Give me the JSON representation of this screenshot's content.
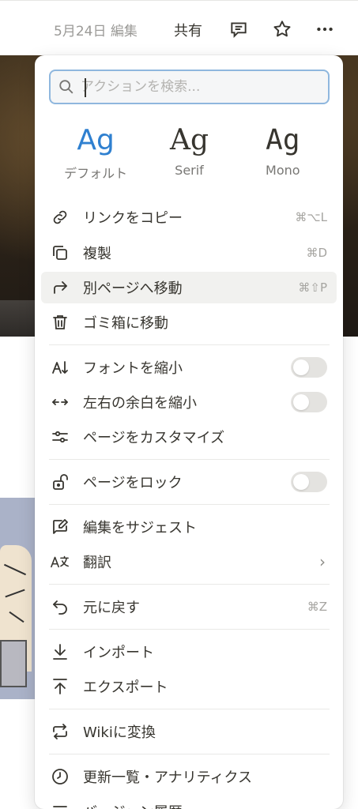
{
  "topbar": {
    "edited": "5月24日 編集",
    "share": "共有",
    "icons": [
      "comment-icon",
      "star-icon",
      "more-icon"
    ]
  },
  "menu": {
    "search": {
      "placeholder": "アクションを検索..."
    },
    "fonts": [
      {
        "sample": "Ag",
        "label": "デフォルト",
        "selected": true
      },
      {
        "sample": "Ag",
        "label": "Serif",
        "selected": false
      },
      {
        "sample": "Ag",
        "label": "Mono",
        "selected": false
      }
    ],
    "items": {
      "copy_link": {
        "label": "リンクをコピー",
        "shortcut": "⌘⌥L",
        "icon": "link-icon"
      },
      "duplicate": {
        "label": "複製",
        "shortcut": "⌘D",
        "icon": "duplicate-icon"
      },
      "move": {
        "label": "別ページへ移動",
        "shortcut": "⌘⇧P",
        "icon": "move-arrow-icon"
      },
      "trash": {
        "label": "ゴミ箱に移動",
        "icon": "trash-icon"
      },
      "small_text": {
        "label": "フォントを縮小",
        "toggle": false,
        "icon": "font-size-icon"
      },
      "full_width": {
        "label": "左右の余白を縮小",
        "toggle": false,
        "icon": "width-arrows-icon"
      },
      "customize": {
        "label": "ページをカスタマイズ",
        "icon": "sliders-icon"
      },
      "lock": {
        "label": "ページをロック",
        "toggle": false,
        "icon": "lock-icon"
      },
      "suggest": {
        "label": "編集をサジェスト",
        "icon": "suggest-edit-icon"
      },
      "translate": {
        "label": "翻訳",
        "icon": "translate-icon"
      },
      "undo": {
        "label": "元に戻す",
        "shortcut": "⌘Z",
        "icon": "undo-icon"
      },
      "import": {
        "label": "インポート",
        "icon": "import-icon"
      },
      "export": {
        "label": "エクスポート",
        "icon": "export-icon"
      },
      "wiki": {
        "label": "Wikiに変換",
        "icon": "wiki-convert-icon"
      },
      "analytics": {
        "label": "更新一覧・アナリティクス",
        "icon": "clock-icon"
      },
      "history": {
        "label": "バージョン履歴",
        "icon": "history-icon"
      }
    },
    "colors": {
      "accent": "#2f80d0",
      "search_border": "#8fb7de",
      "hover_bg": "#f1f1ef"
    }
  }
}
